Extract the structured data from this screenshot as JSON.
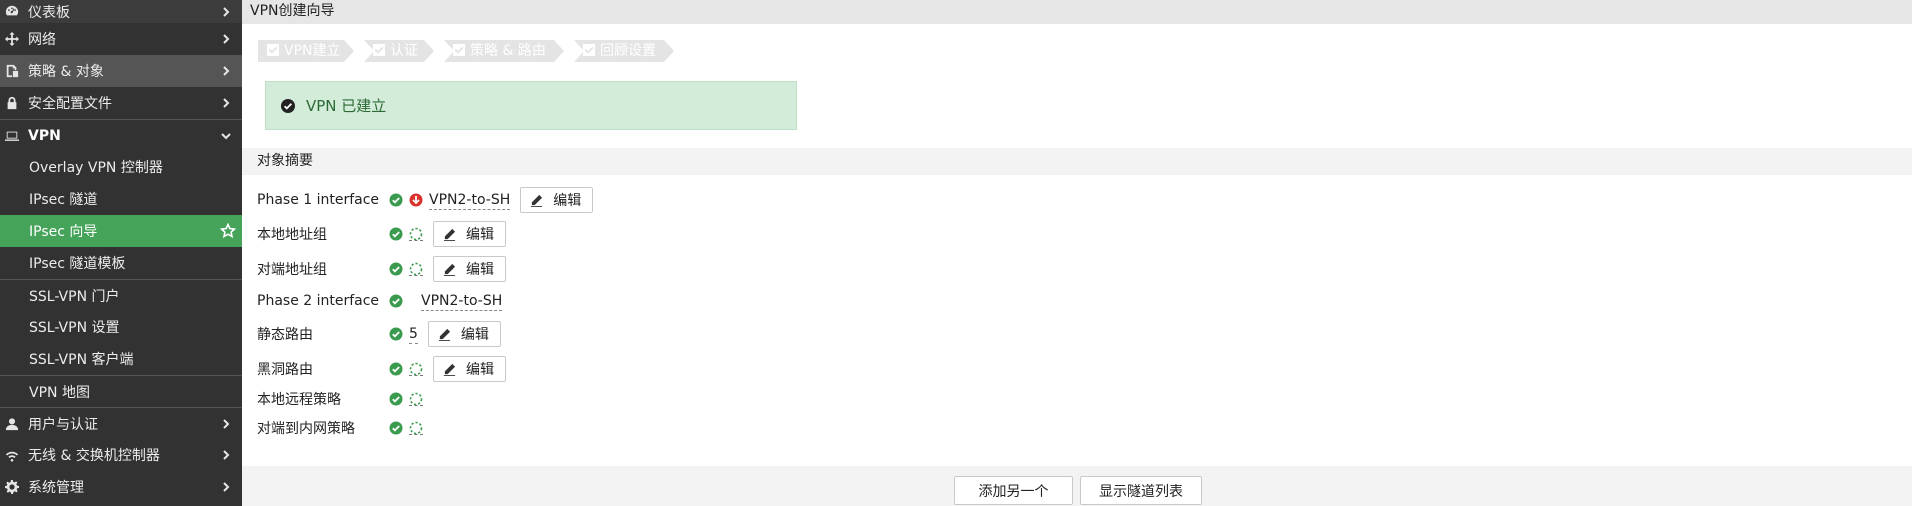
{
  "sidebar": {
    "items": [
      {
        "label": "仪表板",
        "icon": "dashboard-icon"
      },
      {
        "label": "网络",
        "icon": "network-icon"
      },
      {
        "label": "策略 & 对象",
        "icon": "policy-icon"
      },
      {
        "label": "安全配置文件",
        "icon": "lock-icon"
      },
      {
        "label": "VPN",
        "icon": "laptop-icon"
      },
      {
        "label": "Overlay VPN 控制器"
      },
      {
        "label": "IPsec 隧道"
      },
      {
        "label": "IPsec 向导"
      },
      {
        "label": "IPsec 隧道模板"
      },
      {
        "label": "SSL-VPN 门户"
      },
      {
        "label": "SSL-VPN 设置"
      },
      {
        "label": "SSL-VPN 客户端"
      },
      {
        "label": "VPN 地图"
      },
      {
        "label": "用户与认证",
        "icon": "user-icon"
      },
      {
        "label": "无线 & 交换机控制器",
        "icon": "wifi-icon"
      },
      {
        "label": "系统管理",
        "icon": "gear-icon"
      }
    ]
  },
  "main": {
    "title": "VPN创建向导",
    "steps": [
      "VPN建立",
      "认证",
      "策略 & 路由",
      "回顾设置"
    ],
    "success_message": "VPN 已建立",
    "section_title": "对象摘要",
    "edit_label": "编辑",
    "rows": [
      {
        "label": "Phase 1 interface",
        "value": "VPN2-to-SH"
      },
      {
        "label": "本地地址组"
      },
      {
        "label": "对端地址组"
      },
      {
        "label": "Phase 2 interface",
        "value": "VPN2-to-SH"
      },
      {
        "label": "静态路由",
        "value": "5"
      },
      {
        "label": "黑洞路由"
      },
      {
        "label": "本地远程策略"
      },
      {
        "label": "对端到内网策略"
      }
    ],
    "footer": {
      "add_another": "添加另一个",
      "show_tunnel_list": "显示隧道列表"
    }
  },
  "colors": {
    "sidebar_bg": "#323232",
    "active_bg": "#45a35a",
    "success_bg": "#d3ebd9",
    "ok_green": "#3a9a4e",
    "down_red": "#d9312b"
  }
}
